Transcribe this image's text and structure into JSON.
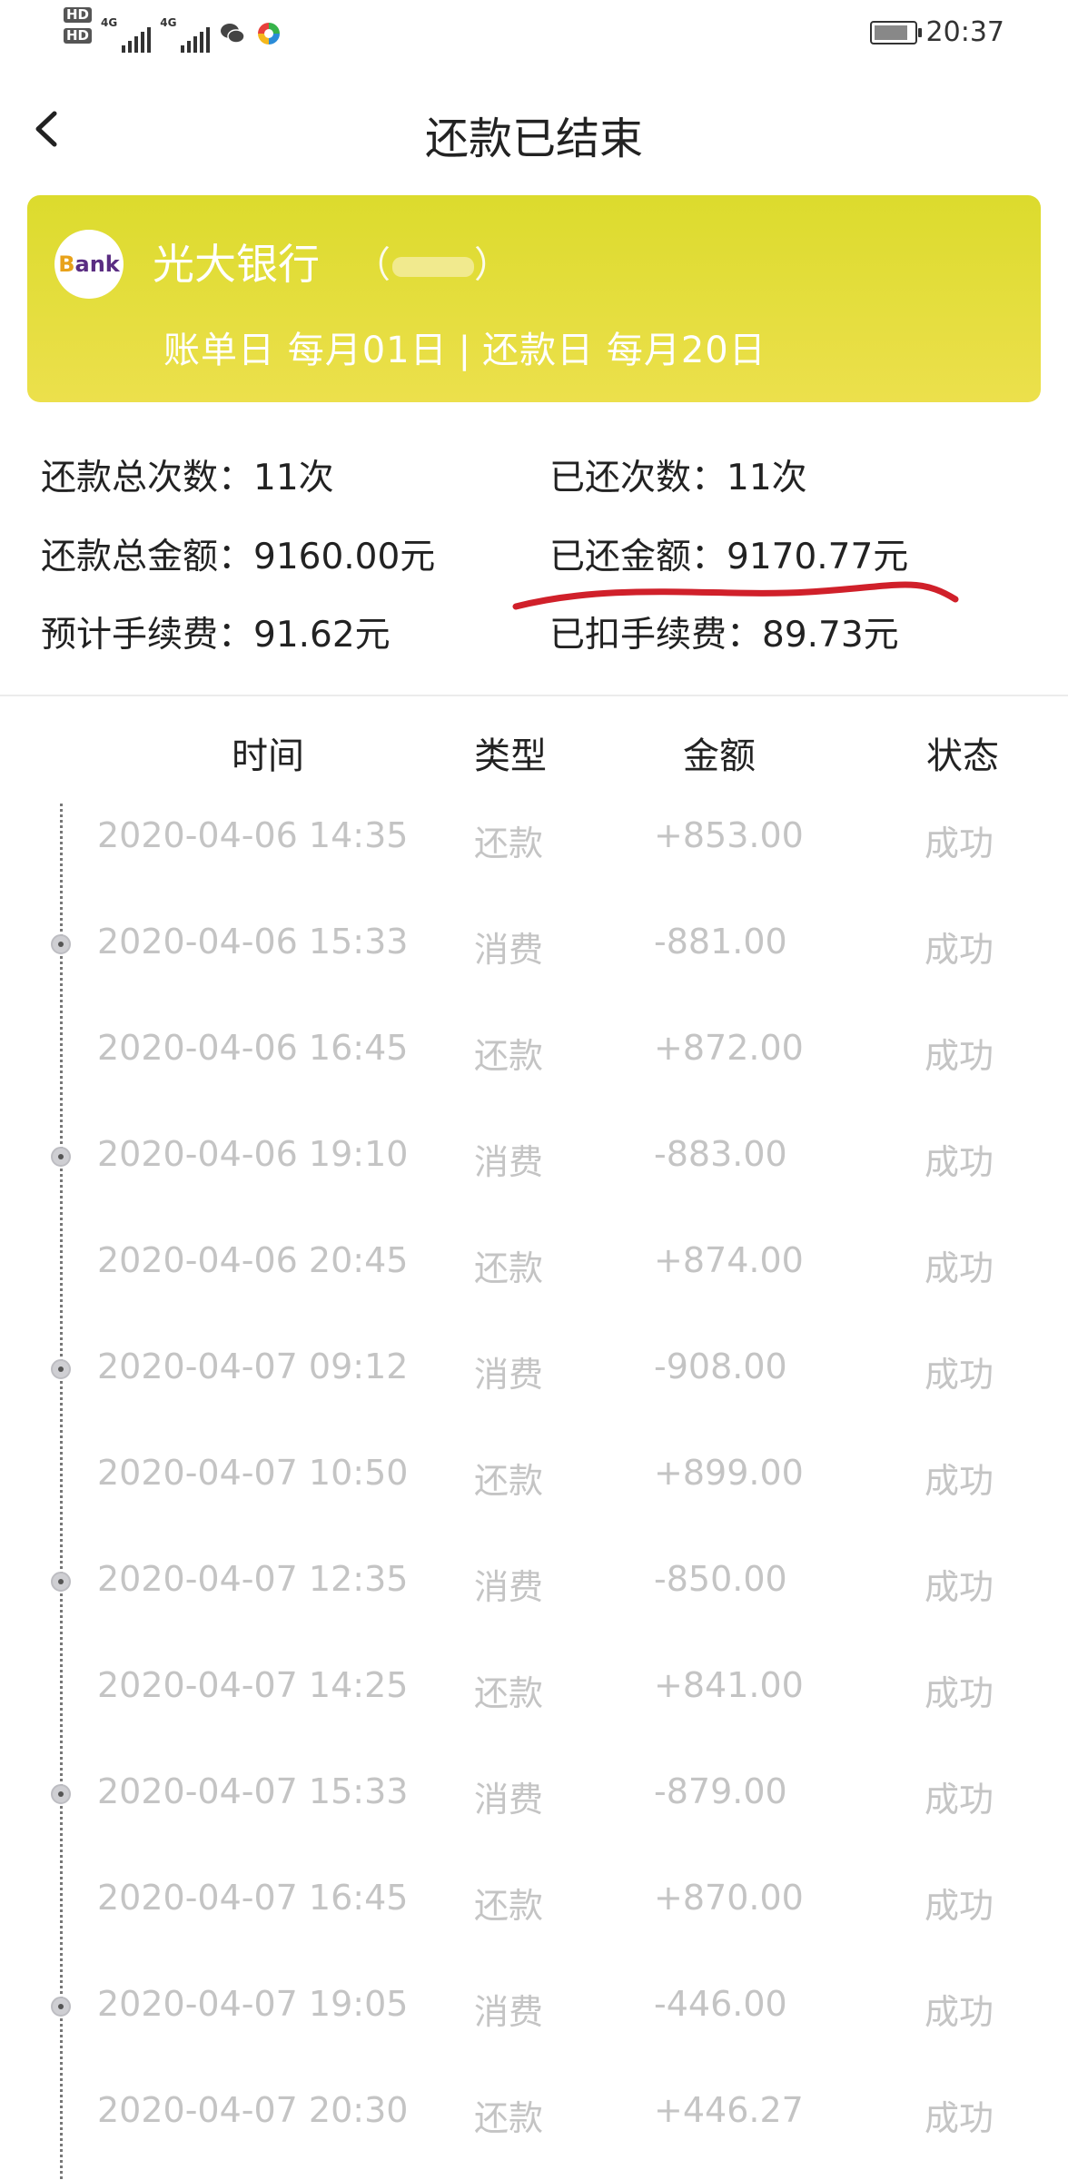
{
  "status_bar": {
    "hd1": "HD",
    "hd2": "HD",
    "sim1_tag": "4G",
    "sim2_tag": "4G",
    "time": "20:37"
  },
  "nav": {
    "title": "还款已结束"
  },
  "card": {
    "logo_b": "B",
    "logo_ank": "ank",
    "bank_name": "光大银行",
    "bill_day_label": "账单日",
    "bill_day_value": "每月01日",
    "separator": "|",
    "repay_day_label": "还款日",
    "repay_day_value": "每月20日"
  },
  "stats": {
    "total_count": "还款总次数：11次",
    "paid_count": "已还次数：11次",
    "total_amount": "还款总金额：9160.00元",
    "paid_amount": "已还金额：9170.77元",
    "est_fee": "预计手续费：91.62元",
    "deducted_fee": "已扣手续费：89.73元"
  },
  "table": {
    "headers": [
      "时间",
      "类型",
      "金额",
      "状态"
    ],
    "rows": [
      {
        "time": "2020-04-06 14:35",
        "type": "还款",
        "amount": "+853.00",
        "status": "成功"
      },
      {
        "time": "2020-04-06 15:33",
        "type": "消费",
        "amount": "-881.00",
        "status": "成功"
      },
      {
        "time": "2020-04-06 16:45",
        "type": "还款",
        "amount": "+872.00",
        "status": "成功"
      },
      {
        "time": "2020-04-06 19:10",
        "type": "消费",
        "amount": "-883.00",
        "status": "成功"
      },
      {
        "time": "2020-04-06 20:45",
        "type": "还款",
        "amount": "+874.00",
        "status": "成功"
      },
      {
        "time": "2020-04-07 09:12",
        "type": "消费",
        "amount": "-908.00",
        "status": "成功"
      },
      {
        "time": "2020-04-07 10:50",
        "type": "还款",
        "amount": "+899.00",
        "status": "成功"
      },
      {
        "time": "2020-04-07 12:35",
        "type": "消费",
        "amount": "-850.00",
        "status": "成功"
      },
      {
        "time": "2020-04-07 14:25",
        "type": "还款",
        "amount": "+841.00",
        "status": "成功"
      },
      {
        "time": "2020-04-07 15:33",
        "type": "消费",
        "amount": "-879.00",
        "status": "成功"
      },
      {
        "time": "2020-04-07 16:45",
        "type": "还款",
        "amount": "+870.00",
        "status": "成功"
      },
      {
        "time": "2020-04-07 19:05",
        "type": "消费",
        "amount": "-446.00",
        "status": "成功"
      },
      {
        "time": "2020-04-07 20:30",
        "type": "还款",
        "amount": "+446.27",
        "status": "成功"
      }
    ]
  },
  "colors": {
    "card_top": "#dcdb2d",
    "card_bottom": "#ece04c",
    "annotation_red": "#d0202a",
    "row_text": "#c4c4c4"
  }
}
